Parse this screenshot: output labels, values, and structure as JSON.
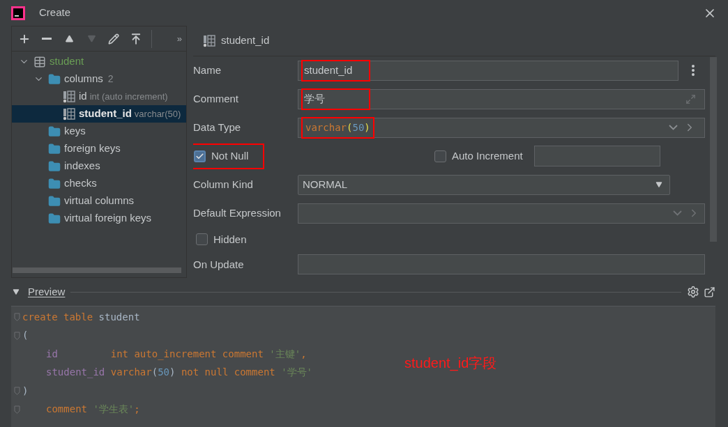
{
  "window": {
    "title": "Create"
  },
  "toolbar": {
    "buttons": [
      {
        "kind": "add",
        "disabled": false
      },
      {
        "kind": "remove",
        "disabled": false
      },
      {
        "kind": "up",
        "disabled": false
      },
      {
        "kind": "down",
        "disabled": true
      },
      {
        "kind": "edit",
        "disabled": false
      },
      {
        "kind": "export",
        "disabled": false
      }
    ],
    "more": "»"
  },
  "tree": [
    {
      "label": "student",
      "kind": "table",
      "expanded": true,
      "selected": false,
      "children": [
        {
          "label": "columns",
          "count": "2",
          "kind": "folder",
          "expanded": true,
          "selected": false,
          "children": [
            {
              "label": "id",
              "detail": "int (auto increment)",
              "kind": "column",
              "selected": false
            },
            {
              "label": "student_id",
              "detail": "varchar(50)",
              "kind": "column",
              "selected": true
            }
          ]
        },
        {
          "label": "keys",
          "kind": "folder",
          "selected": false
        },
        {
          "label": "foreign keys",
          "kind": "folder",
          "selected": false
        },
        {
          "label": "indexes",
          "kind": "folder",
          "selected": false
        },
        {
          "label": "checks",
          "kind": "folder",
          "selected": false
        },
        {
          "label": "virtual columns",
          "kind": "folder",
          "selected": false
        },
        {
          "label": "virtual foreign keys",
          "kind": "folder",
          "selected": false
        }
      ]
    }
  ],
  "editor": {
    "header": "student_id",
    "rows": [
      {
        "kind": "text-menu",
        "label": "Name",
        "value": "student_id",
        "highlighted": true
      },
      {
        "kind": "text-expand",
        "label": "Comment",
        "value": "学号",
        "highlighted": true
      },
      {
        "kind": "type",
        "label": "Data Type",
        "tokens": [
          {
            "text": "varchar",
            "kind": "keyword"
          },
          {
            "text": "(",
            "kind": "paren"
          },
          {
            "text": "50",
            "kind": "number"
          },
          {
            "text": ")",
            "kind": "paren"
          }
        ],
        "highlighted": true
      },
      {
        "kind": "checkbox-pair",
        "label": "Not Null",
        "checked": true,
        "highlighted": true,
        "label2": "Auto Increment",
        "checked2": false
      },
      {
        "kind": "select",
        "label": "Column Kind",
        "value": "NORMAL"
      },
      {
        "kind": "combo",
        "label": "Default Expression"
      },
      {
        "kind": "checkbox",
        "label": "Hidden",
        "checked": false
      },
      {
        "kind": "text",
        "label": "On Update"
      }
    ]
  },
  "preview": {
    "title": "Preview",
    "expanded": true,
    "lines": [
      {
        "fold": true,
        "indent": false,
        "tokens": [
          {
            "text": "create table ",
            "kind": "keyword"
          },
          {
            "text": "student",
            "kind": "plain"
          }
        ]
      },
      {
        "fold": true,
        "indent": false,
        "tokens": [
          {
            "text": "(",
            "kind": "plain"
          }
        ]
      },
      {
        "fold": false,
        "indent": true,
        "tokens": [
          {
            "text": "id",
            "kind": "column"
          },
          {
            "text": "         int auto_increment comment ",
            "kind": "keyword"
          },
          {
            "text": "'主键'",
            "kind": "string"
          },
          {
            "text": ",",
            "kind": "keyword"
          }
        ]
      },
      {
        "fold": false,
        "indent": true,
        "tokens": [
          {
            "text": "student_id",
            "kind": "column"
          },
          {
            "text": " varchar",
            "kind": "keyword"
          },
          {
            "text": "(",
            "kind": "plain"
          },
          {
            "text": "50",
            "kind": "number"
          },
          {
            "text": ")",
            "kind": "plain"
          },
          {
            "text": " not null comment ",
            "kind": "keyword"
          },
          {
            "text": "'学号'",
            "kind": "string"
          }
        ]
      },
      {
        "fold": true,
        "indent": false,
        "tokens": [
          {
            "text": ")",
            "kind": "plain"
          }
        ]
      },
      {
        "fold": true,
        "indent": true,
        "tokens": [
          {
            "text": "comment ",
            "kind": "keyword"
          },
          {
            "text": "'学生表'",
            "kind": "string"
          },
          {
            "text": ";",
            "kind": "keyword"
          }
        ]
      }
    ],
    "annotation": "student_id字段"
  }
}
